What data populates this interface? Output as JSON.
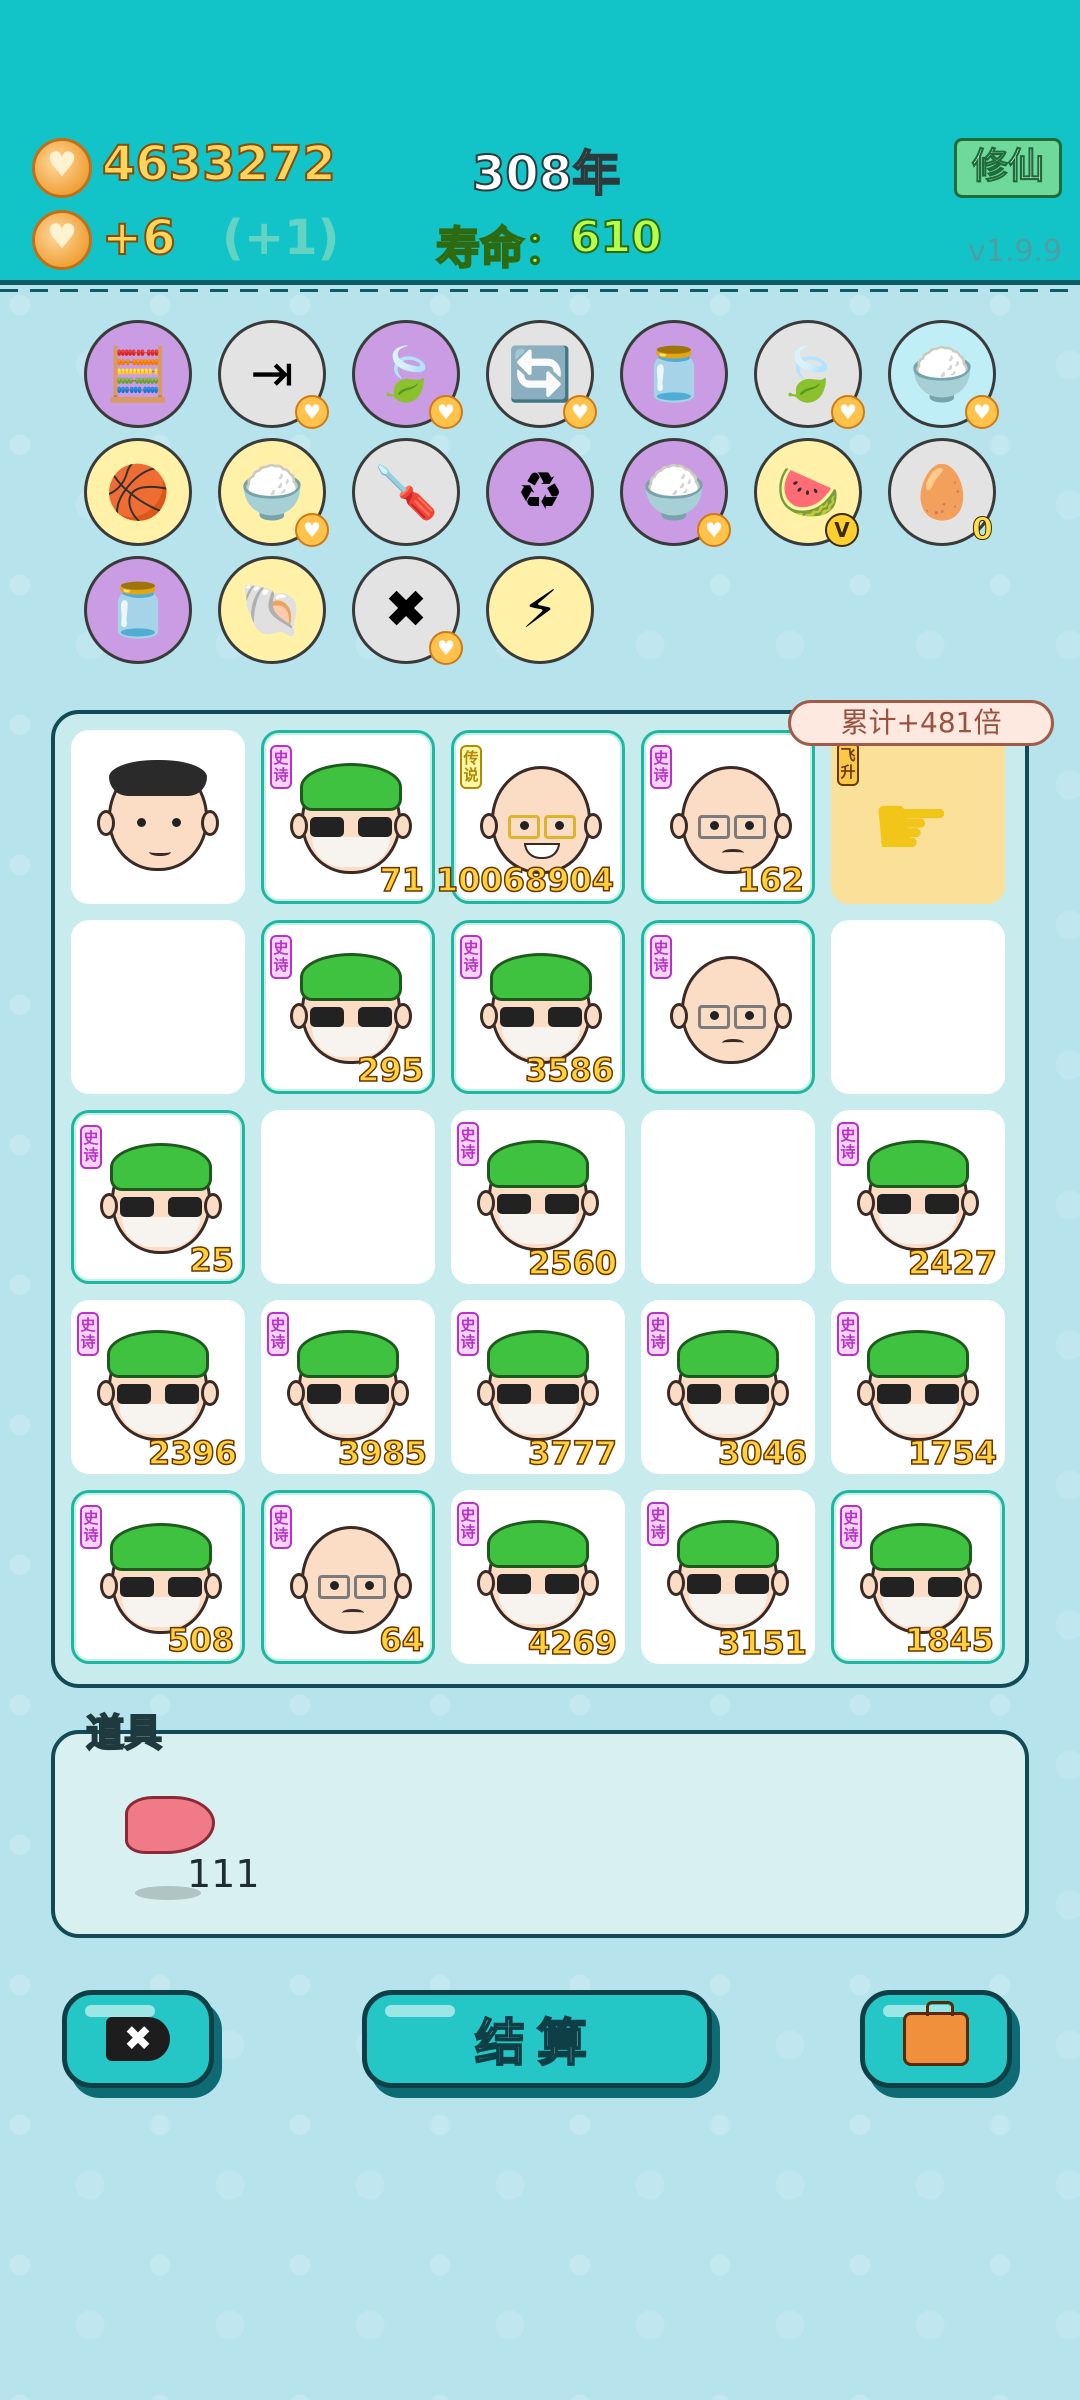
{
  "header": {
    "coins": "4633272",
    "coin_rate": "+6",
    "coin_bonus": "(+1)",
    "year": "308年",
    "lifespan_label": "寿命：",
    "lifespan_value": "610",
    "xiuxian_button": "修仙",
    "version": "v1.9.9"
  },
  "skills": [
    {
      "name": "formula-avatar",
      "icon": "🧮",
      "bg": "#c99ce3",
      "badge": ""
    },
    {
      "name": "skip",
      "icon": "⇥",
      "bg": "#e3e3e3",
      "badge": "heart"
    },
    {
      "name": "leaf",
      "icon": "🍃",
      "bg": "#c99ce3",
      "badge": "heart"
    },
    {
      "name": "refresh",
      "icon": "🔄",
      "bg": "#e3e3e3",
      "badge": "heart"
    },
    {
      "name": "milk-jar",
      "icon": "🫙",
      "bg": "#c99ce3",
      "badge": ""
    },
    {
      "name": "leaf-2",
      "icon": "🍃",
      "bg": "#e3e3e3",
      "badge": "heart"
    },
    {
      "name": "rice-bowl",
      "icon": "🍚",
      "bg": "#bfeef7",
      "badge": "heart"
    },
    {
      "name": "basketballs",
      "icon": "🏀",
      "bg": "#fff2a8",
      "badge": ""
    },
    {
      "name": "rice-bowl-2",
      "icon": "🍚",
      "bg": "#fff2a8",
      "badge": "heart"
    },
    {
      "name": "screwdriver",
      "icon": "🪛",
      "bg": "#e3e3e3",
      "badge": ""
    },
    {
      "name": "recycle",
      "icon": "♻",
      "bg": "#c99ce3",
      "badge": ""
    },
    {
      "name": "rice-bowl-3",
      "icon": "🍚",
      "bg": "#c99ce3",
      "badge": "heart"
    },
    {
      "name": "fruit-plate",
      "icon": "🍉",
      "bg": "#fff2a8",
      "badge": "V"
    },
    {
      "name": "egg-tray",
      "icon": "🥚",
      "bg": "#e3e3e3",
      "badge": ""
    },
    {
      "name": "milk-jar-2",
      "icon": "🫙",
      "bg": "#c99ce3",
      "badge": ""
    },
    {
      "name": "shell",
      "icon": "🐚",
      "bg": "#fff2a8",
      "badge": ""
    },
    {
      "name": "close-tag",
      "icon": "✖",
      "bg": "#e3e3e3",
      "badge": "heart"
    },
    {
      "name": "lightning",
      "icon": "⚡",
      "bg": "#fff2a8",
      "badge": ""
    }
  ],
  "egg_tray_count": "0",
  "board": {
    "bonus": "累计+481倍",
    "cells": [
      {
        "type": "boy",
        "tag": "",
        "num": "",
        "hl": false
      },
      {
        "type": "green",
        "tag": "史诗",
        "num": "71",
        "hl": true
      },
      {
        "type": "gold",
        "tag": "传说",
        "num": "10068904",
        "hl": true
      },
      {
        "type": "bald",
        "tag": "史诗",
        "num": "162",
        "hl": true
      },
      {
        "type": "fly",
        "tag": "飞升",
        "num": "",
        "hl": false
      },
      {
        "type": "empty",
        "tag": "",
        "num": "",
        "hl": false
      },
      {
        "type": "green",
        "tag": "史诗",
        "num": "295",
        "hl": true
      },
      {
        "type": "green",
        "tag": "史诗",
        "num": "3586",
        "hl": true
      },
      {
        "type": "bald",
        "tag": "史诗",
        "num": "",
        "hl": true
      },
      {
        "type": "empty",
        "tag": "",
        "num": "",
        "hl": false
      },
      {
        "type": "green",
        "tag": "史诗",
        "num": "25",
        "hl": true
      },
      {
        "type": "empty",
        "tag": "",
        "num": "",
        "hl": false
      },
      {
        "type": "green",
        "tag": "史诗",
        "num": "2560",
        "hl": false
      },
      {
        "type": "empty",
        "tag": "",
        "num": "",
        "hl": false
      },
      {
        "type": "green",
        "tag": "史诗",
        "num": "2427",
        "hl": false
      },
      {
        "type": "green",
        "tag": "史诗",
        "num": "2396",
        "hl": false
      },
      {
        "type": "green",
        "tag": "史诗",
        "num": "3985",
        "hl": false
      },
      {
        "type": "green",
        "tag": "史诗",
        "num": "3777",
        "hl": false
      },
      {
        "type": "green",
        "tag": "史诗",
        "num": "3046",
        "hl": false
      },
      {
        "type": "green",
        "tag": "史诗",
        "num": "1754",
        "hl": false
      },
      {
        "type": "green",
        "tag": "史诗",
        "num": "508",
        "hl": true
      },
      {
        "type": "bald",
        "tag": "史诗",
        "num": "64",
        "hl": true
      },
      {
        "type": "green",
        "tag": "史诗",
        "num": "4269",
        "hl": false
      },
      {
        "type": "green",
        "tag": "史诗",
        "num": "3151",
        "hl": false
      },
      {
        "type": "green",
        "tag": "史诗",
        "num": "1845",
        "hl": true
      }
    ]
  },
  "items": {
    "title": "道具",
    "liver_count": "111"
  },
  "buttons": {
    "settle": "结算",
    "close_icon": "✖"
  }
}
